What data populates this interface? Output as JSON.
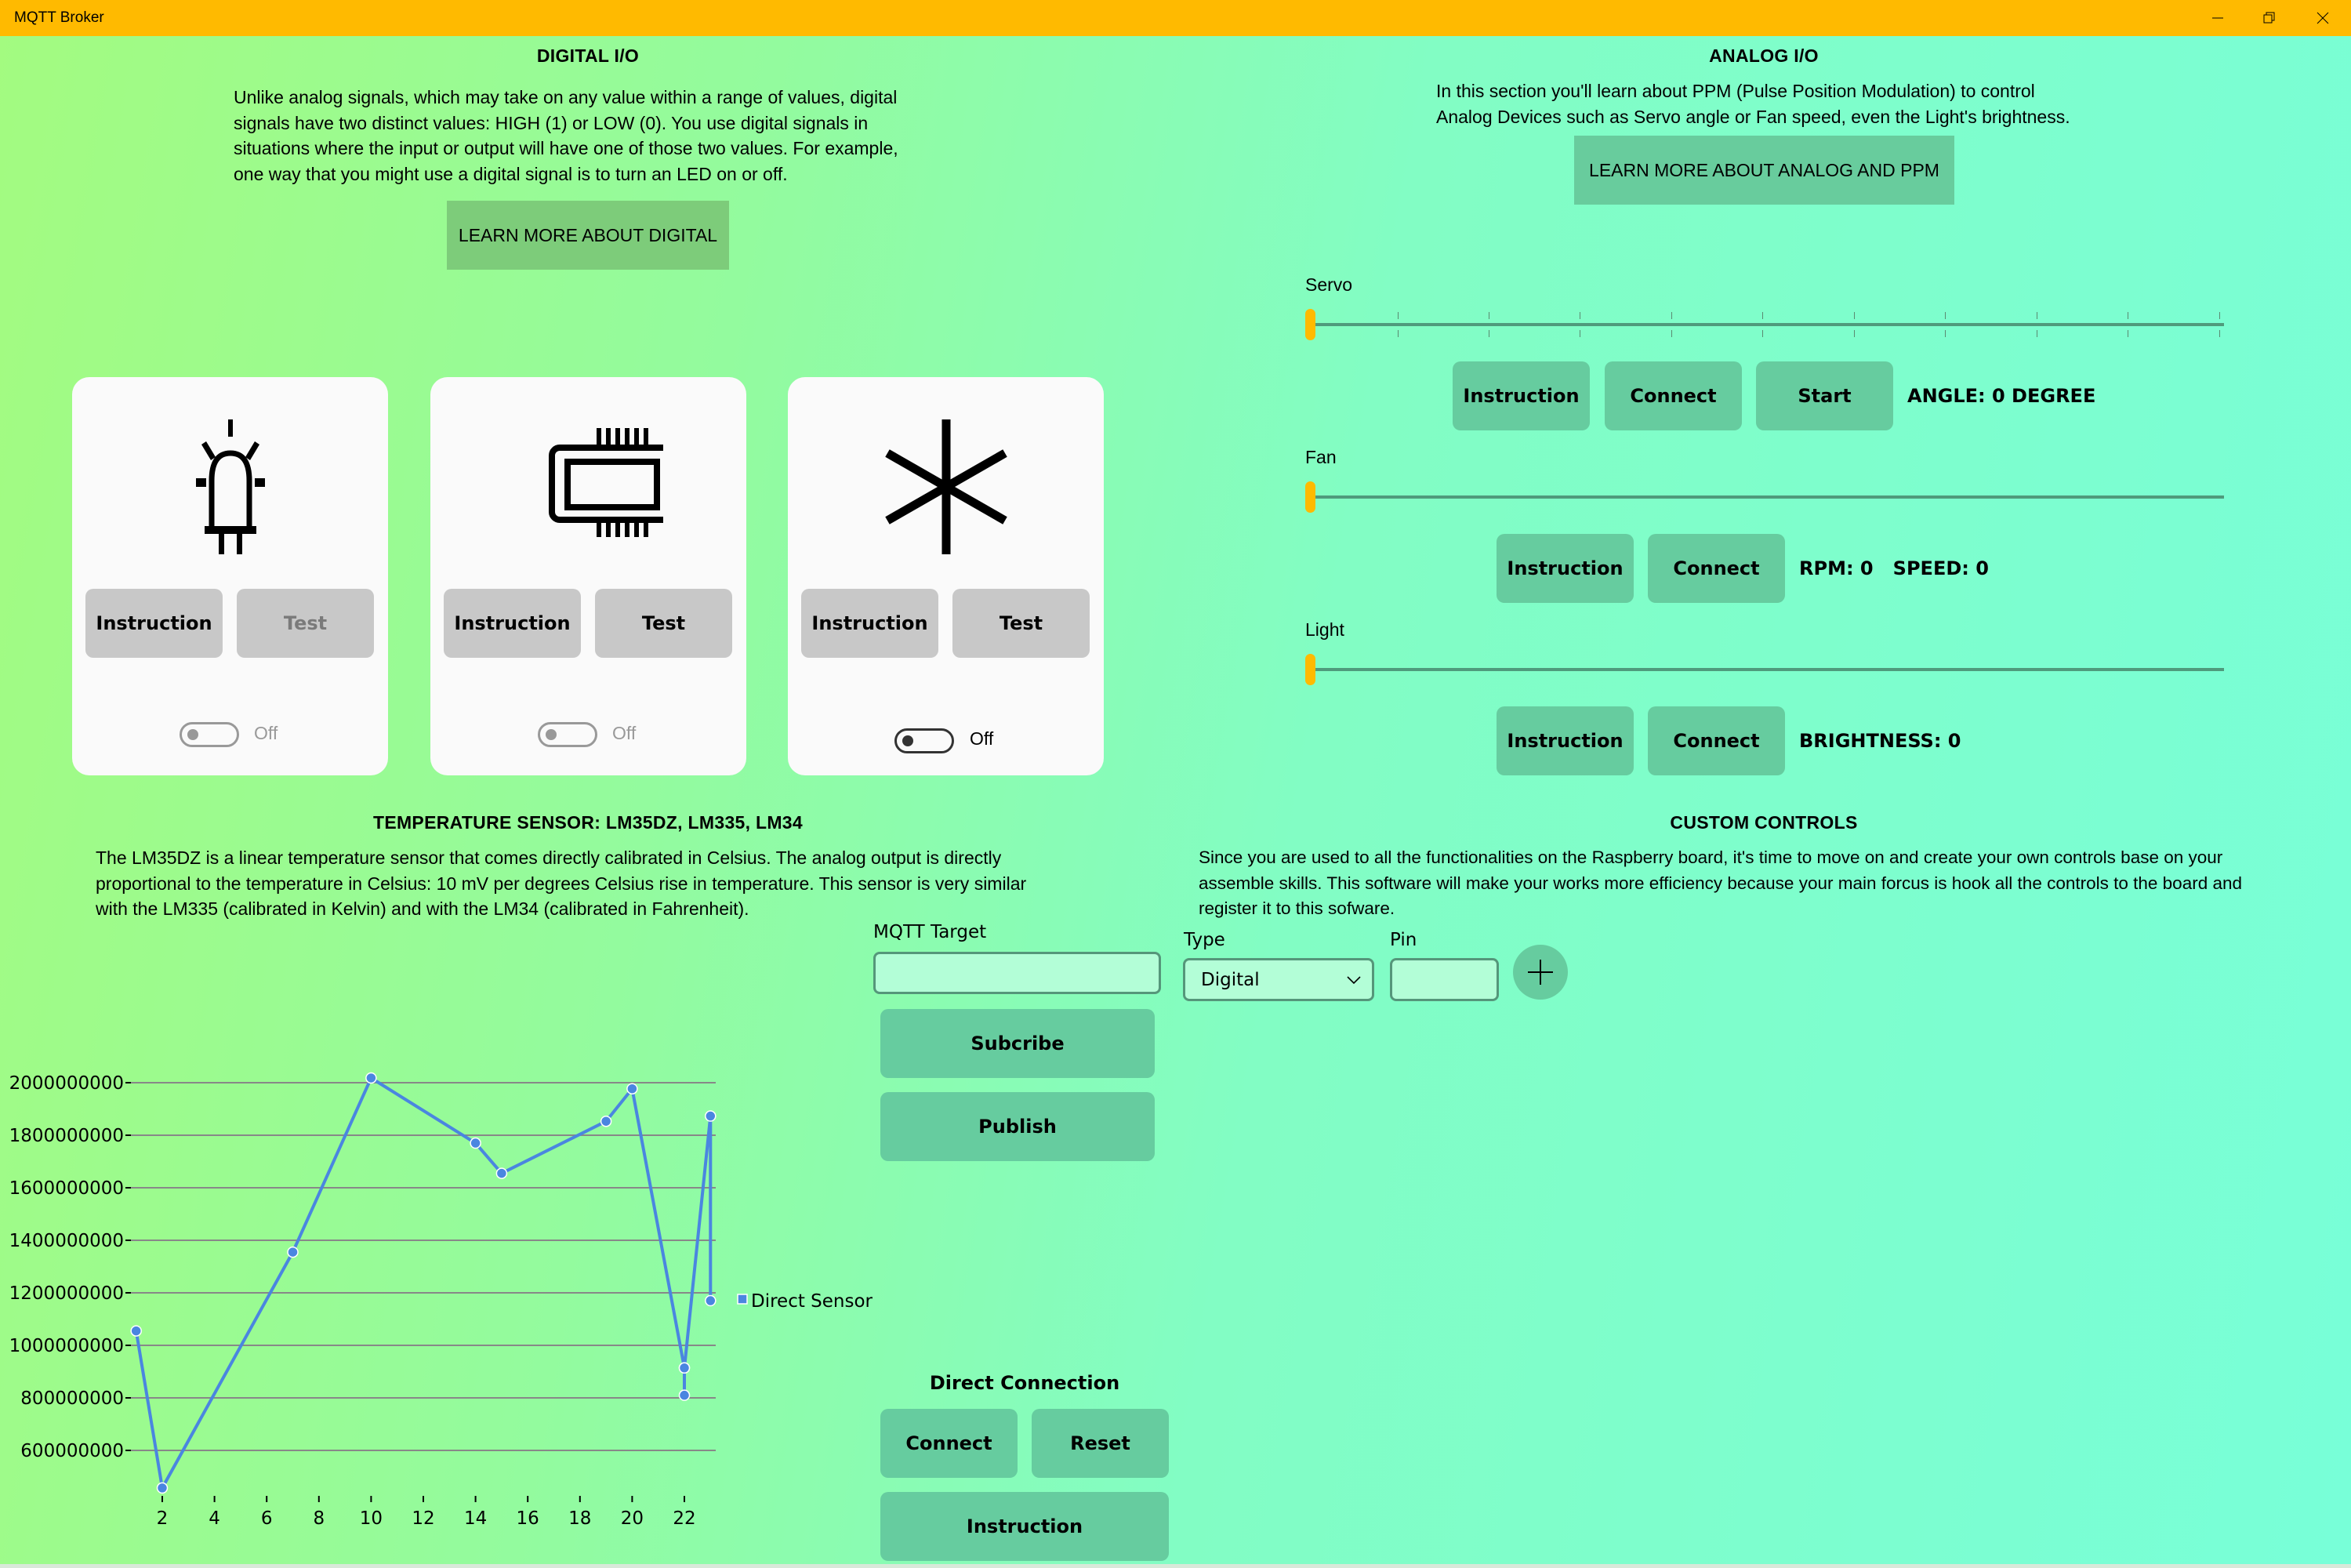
{
  "window": {
    "title": "MQTT Broker",
    "controls": [
      "minimize-icon",
      "restore-icon",
      "close-icon"
    ]
  },
  "colors": {
    "titlebar": "#FFBA00",
    "accent_thumb": "#FFBA00",
    "button_teal": "#66CC9F",
    "button_green": "#7DCC7A",
    "card_bg": "#FAFAFA",
    "card_button": "#C8C8C8",
    "series": "#4A86E0"
  },
  "digital": {
    "title": "DIGITAL I/O",
    "description_lines": [
      "Unlike analog signals, which may take on any value within a range of values, digital",
      "signals have two distinct values: HIGH (1) or LOW (0). You use digital signals in",
      "situations where the input or output will have one of those two values. For example,",
      "one way that you might use a digital signal is to turn an LED on or off."
    ],
    "learn_more": "LEARN MORE ABOUT DIGITAL",
    "cards": [
      {
        "icon": "led-icon",
        "instruction": "Instruction",
        "test": "Test",
        "test_enabled": false,
        "toggle_label": "Off",
        "toggle_enabled": false
      },
      {
        "icon": "chip-icon",
        "instruction": "Instruction",
        "test": "Test",
        "test_enabled": true,
        "toggle_label": "Off",
        "toggle_enabled": false
      },
      {
        "icon": "asterisk-icon",
        "instruction": "Instruction",
        "test": "Test",
        "test_enabled": true,
        "toggle_label": "Off",
        "toggle_enabled": true
      }
    ]
  },
  "analog": {
    "title": "ANALOG I/O",
    "description_lines": [
      "In this section you'll learn about PPM (Pulse Position Modulation) to control",
      "Analog Devices such as Servo angle or Fan speed, even the Light's brightness."
    ],
    "learn_more": "LEARN MORE ABOUT ANALOG AND PPM",
    "servo": {
      "label": "Servo",
      "value": 0,
      "instruction": "Instruction",
      "connect": "Connect",
      "start": "Start",
      "readout": "ANGLE: 0 DEGREE"
    },
    "fan": {
      "label": "Fan",
      "value": 0,
      "instruction": "Instruction",
      "connect": "Connect",
      "readout": "RPM: 0   SPEED: 0"
    },
    "light": {
      "label": "Light",
      "value": 0,
      "instruction": "Instruction",
      "connect": "Connect",
      "readout": "BRIGHTNESS: 0"
    }
  },
  "temperature": {
    "title": "TEMPERATURE SENSOR: LM35DZ, LM335, LM34",
    "description_lines": [
      "The LM35DZ is a linear temperature sensor that comes directly calibrated in Celsius.  The analog output is directly",
      "proportional to the temperature in Celsius: 10 mV per degrees Celsius rise in temperature.  This sensor is very similar",
      "with the LM335 (calibrated in Kelvin) and with the LM34 (calibrated in Fahrenheit)."
    ]
  },
  "mqtt": {
    "target_label": "MQTT Target",
    "target_value": "",
    "subscribe": "Subcribe",
    "publish": "Publish"
  },
  "direct_connection": {
    "title": "Direct Connection",
    "connect": "Connect",
    "reset": "Reset",
    "instruction": "Instruction"
  },
  "custom": {
    "title": "CUSTOM CONTROLS",
    "description_lines": [
      "Since you are used to all the functionalities on the Raspberry board, it's time to move on and create your own controls base on your",
      "assemble skills. This software will make your works more efficiency because your main forcus is hook all the controls to the board and",
      "register it to this sofware."
    ],
    "type_label": "Type",
    "type_value": "Digital",
    "pin_label": "Pin",
    "pin_value": "",
    "add_icon": "plus-icon"
  },
  "chart_data": {
    "type": "line",
    "title": "",
    "xlabel": "",
    "ylabel": "",
    "xlim": [
      0.5,
      23.5
    ],
    "ylim": [
      430000000,
      2060000000
    ],
    "x_ticks": [
      2,
      4,
      6,
      8,
      10,
      12,
      14,
      16,
      18,
      20,
      22
    ],
    "y_ticks": [
      600000000,
      800000000,
      1000000000,
      1200000000,
      1400000000,
      1600000000,
      1800000000,
      2000000000
    ],
    "y_tick_labels": [
      "600000000",
      "800000000",
      "1000000000",
      "1200000000",
      "1400000000",
      "1600000000",
      "1800000000",
      "2000000000"
    ],
    "grid": true,
    "legend": "right",
    "series": [
      {
        "name": "Direct Sensor",
        "color": "#4A86E0",
        "x": [
          1,
          2,
          7,
          10,
          14,
          15,
          19,
          20,
          22,
          22,
          22,
          23,
          23
        ],
        "values": [
          1055000000,
          457000000,
          1355000000,
          2018000000,
          1770000000,
          1655000000,
          1853000000,
          1977000000,
          914000000,
          810000000,
          914000000,
          1873000000,
          1170000000
        ]
      }
    ]
  }
}
